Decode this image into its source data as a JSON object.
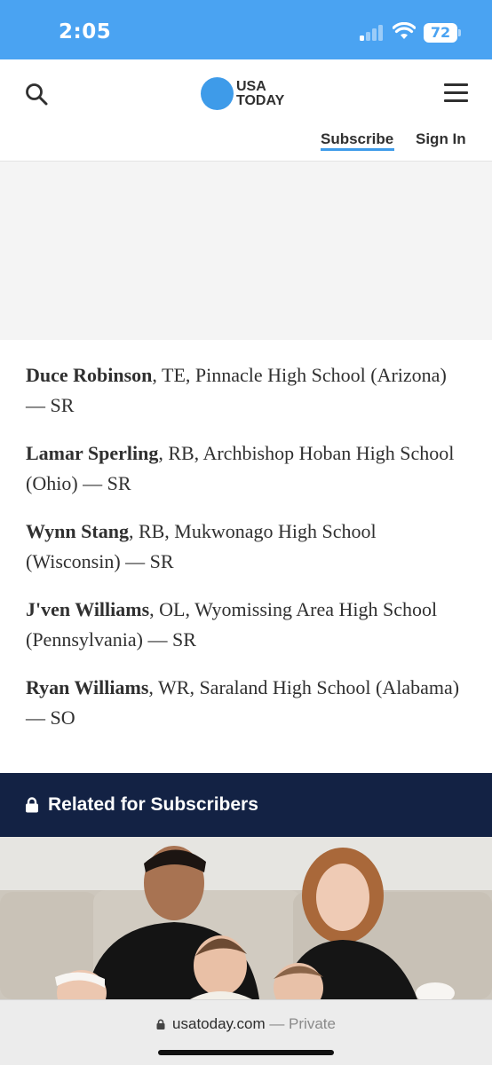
{
  "status_bar": {
    "time": "2:05",
    "battery": "72",
    "background_color": "#4aa3f2"
  },
  "header": {
    "logo_line1": "USA",
    "logo_line2": "TODAY",
    "subscribe": "Subscribe",
    "sign_in": "Sign In",
    "brand_color": "#3e9be9",
    "icons": [
      "search-icon",
      "hamburger-menu-icon"
    ]
  },
  "article": {
    "players": [
      {
        "name": "Duce Robinson",
        "details": ", TE, Pinnacle High School (Arizona) — SR"
      },
      {
        "name": "Lamar Sperling",
        "details": ", RB, Archbishop Hoban High School (Ohio) — SR"
      },
      {
        "name": "Wynn Stang",
        "details": ", RB, Mukwonago High School (Wisconsin) — SR"
      },
      {
        "name": "J'ven Williams",
        "details": ", OL, Wyomissing Area High School (Pennsylvania) — SR"
      },
      {
        "name": "Ryan Williams",
        "details": ", WR, Saraland High School (Alabama) — SO"
      }
    ]
  },
  "related": {
    "title": "Related for Subscribers",
    "band_color": "#132244",
    "icon": "lock-icon"
  },
  "browser": {
    "domain": "usatoday.com",
    "mode": " — Private"
  }
}
